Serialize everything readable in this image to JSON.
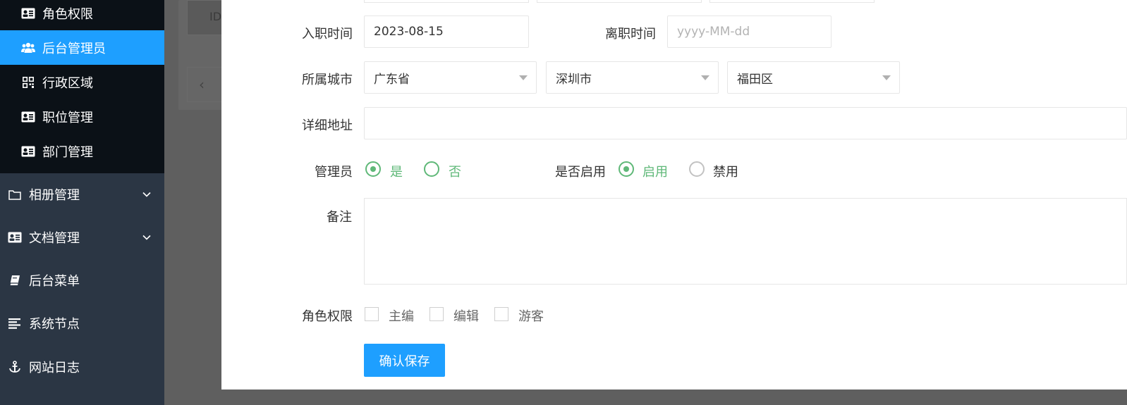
{
  "sidebar": {
    "sub_items": [
      {
        "label": "角色权限",
        "icon": "id-card-icon",
        "active": false
      },
      {
        "label": "后台管理员",
        "icon": "users-icon",
        "active": true
      },
      {
        "label": "行政区域",
        "icon": "qrcode-icon",
        "active": false
      },
      {
        "label": "职位管理",
        "icon": "id-card-icon",
        "active": false
      },
      {
        "label": "部门管理",
        "icon": "id-card-icon",
        "active": false
      }
    ],
    "nav_items": [
      {
        "label": "相册管理",
        "icon": "folder-icon",
        "expandable": true
      },
      {
        "label": "文档管理",
        "icon": "id-card-icon",
        "expandable": true
      },
      {
        "label": "后台菜单",
        "icon": "book-icon",
        "expandable": false
      },
      {
        "label": "系统节点",
        "icon": "align-left-icon",
        "expandable": false
      },
      {
        "label": "网站日志",
        "icon": "anchor-icon",
        "expandable": false
      }
    ]
  },
  "background": {
    "table_header_id": "ID"
  },
  "form": {
    "hire_date": {
      "label": "入职时间",
      "value": "2023-08-15"
    },
    "leave_date": {
      "label": "离职时间",
      "placeholder": "yyyy-MM-dd"
    },
    "city": {
      "label": "所属城市",
      "province": "广东省",
      "city": "深圳市",
      "district": "福田区"
    },
    "address": {
      "label": "详细地址",
      "value": ""
    },
    "admin": {
      "label": "管理员",
      "options": [
        "是",
        "否"
      ],
      "selected": "是"
    },
    "enabled": {
      "label": "是否启用",
      "options": [
        "启用",
        "禁用"
      ],
      "selected": "启用"
    },
    "remark": {
      "label": "备注",
      "value": ""
    },
    "roles": {
      "label": "角色权限",
      "options": [
        "主编",
        "编辑",
        "游客"
      ]
    },
    "save_label": "确认保存"
  },
  "colors": {
    "sidebar_bg": "#2b3644",
    "sidebar_sub_bg": "#0b1117",
    "active_blue": "#1e9fff",
    "radio_green": "#5fb878"
  }
}
